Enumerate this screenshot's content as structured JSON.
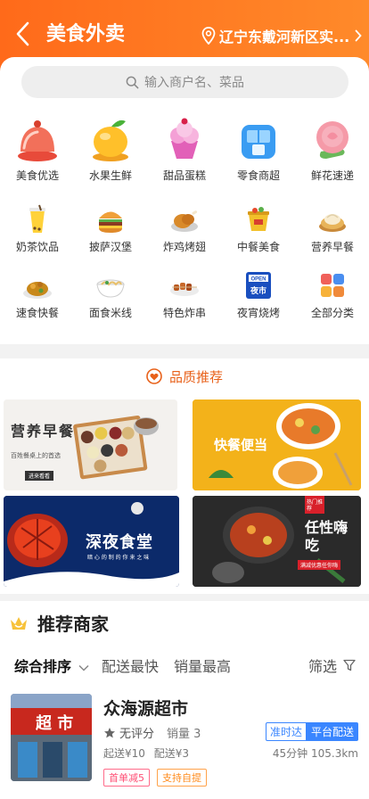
{
  "header": {
    "title": "美食外卖",
    "location": "辽宁东戴河新区实..."
  },
  "search": {
    "placeholder": "输入商户名、菜品"
  },
  "categories": [
    {
      "label": "美食优选",
      "icon": "cake-bell-icon"
    },
    {
      "label": "水果生鲜",
      "icon": "mango-icon"
    },
    {
      "label": "甜品蛋糕",
      "icon": "ice-cream-icon"
    },
    {
      "label": "零食商超",
      "icon": "store-icon"
    },
    {
      "label": "鲜花速递",
      "icon": "rose-icon"
    },
    {
      "label": "奶茶饮品",
      "icon": "milk-tea-icon"
    },
    {
      "label": "披萨汉堡",
      "icon": "burger-icon"
    },
    {
      "label": "炸鸡烤翅",
      "icon": "fried-chicken-icon"
    },
    {
      "label": "中餐美食",
      "icon": "chinese-food-icon"
    },
    {
      "label": "营养早餐",
      "icon": "dumpling-icon"
    },
    {
      "label": "速食快餐",
      "icon": "fast-food-icon"
    },
    {
      "label": "面食米线",
      "icon": "noodle-icon"
    },
    {
      "label": "特色炸串",
      "icon": "skewer-icon"
    },
    {
      "label": "夜宵烧烤",
      "icon": "night-market-icon"
    },
    {
      "label": "全部分类",
      "icon": "all-categories-icon"
    }
  ],
  "quality": {
    "title": "品质推荐",
    "banners": [
      {
        "title": "营养早餐",
        "sub": "百姓餐桌上的首选",
        "button": "进来看看"
      },
      {
        "title": "快餐便当"
      },
      {
        "title": "深夜食堂",
        "sub": "暗 心 的 制 的 你 来 之 味"
      },
      {
        "title": "任性嗨吃",
        "sub": "满减优惠任你嗨",
        "tag": "热门推荐"
      }
    ],
    "night_badge": {
      "top": "OPEN",
      "bottom": "夜市"
    }
  },
  "recommend": {
    "title": "推荐商家",
    "sorts": [
      "综合排序",
      "配送最快",
      "销量最高",
      "筛选"
    ]
  },
  "shop": {
    "name": "众海源超市",
    "sign": "超 市",
    "rating": "无评分",
    "sales": "销量 3",
    "min_order": "起送¥10",
    "delivery_fee": "配送¥3",
    "badge_ontime": "准时达",
    "badge_platform": "平台配送",
    "time": "45分钟",
    "distance": "105.3km",
    "tag_first": "首单减5",
    "tag_pickup": "支持自提"
  },
  "colors": {
    "brand": "#ff7422",
    "accent_blue": "#3a86ff"
  }
}
